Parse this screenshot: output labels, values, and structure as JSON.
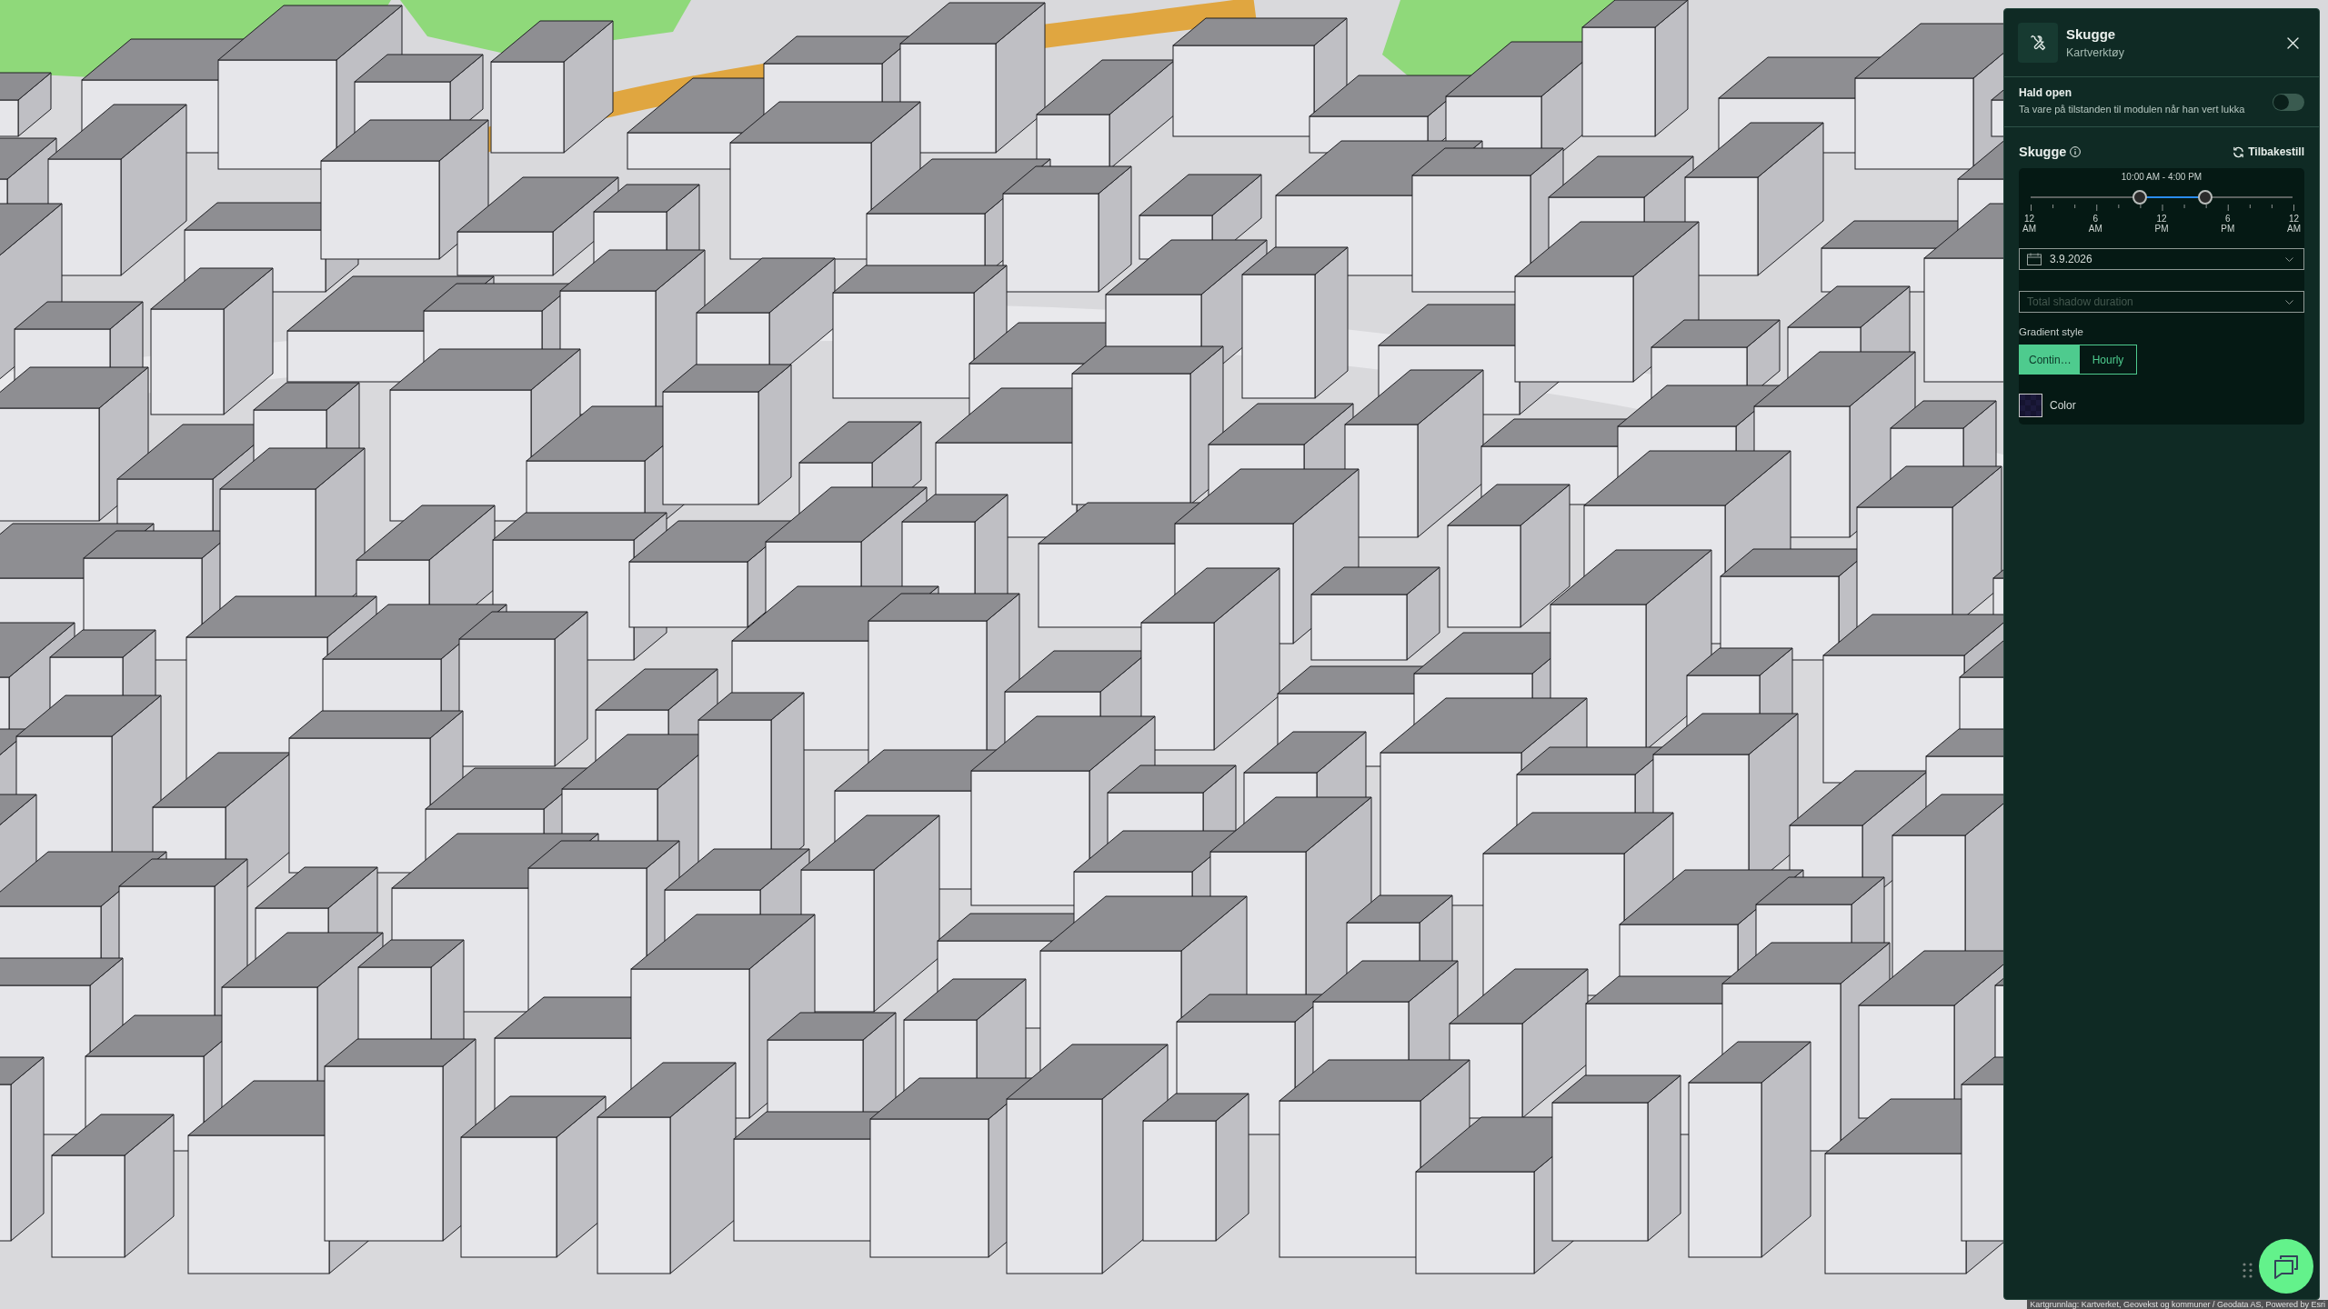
{
  "map": {
    "attribution": "Kartgrunnlag: Kartverket, Geovekst og kommuner / Geodata AS, Powered by Esri"
  },
  "panel": {
    "title": "Skugge",
    "subtitle": "Kartverktøy",
    "keep_open": {
      "label": "Hald open",
      "description": "Ta vare på tilstanden til modulen når han vert lukka",
      "on": false
    },
    "section": {
      "title": "Skugge",
      "reset_label": "Tilbakestill"
    },
    "time_slider": {
      "range_label": "10:00 AM - 4:00 PM",
      "handles": [
        {
          "level": 0.4167
        },
        {
          "level": 0.6667
        }
      ],
      "tick_labels": [
        "12 AM",
        "6 AM",
        "12 PM",
        "6 PM",
        "12 AM"
      ]
    },
    "date_field": {
      "value": "3.9.2026"
    },
    "duration_select": {
      "placeholder": "Total shadow duration"
    },
    "gradient_style": {
      "label": "Gradient style",
      "options": [
        {
          "label": "Contin…",
          "selected": true
        },
        {
          "label": "Hourly",
          "selected": false
        }
      ]
    },
    "color_picker": {
      "label": "Color"
    }
  }
}
